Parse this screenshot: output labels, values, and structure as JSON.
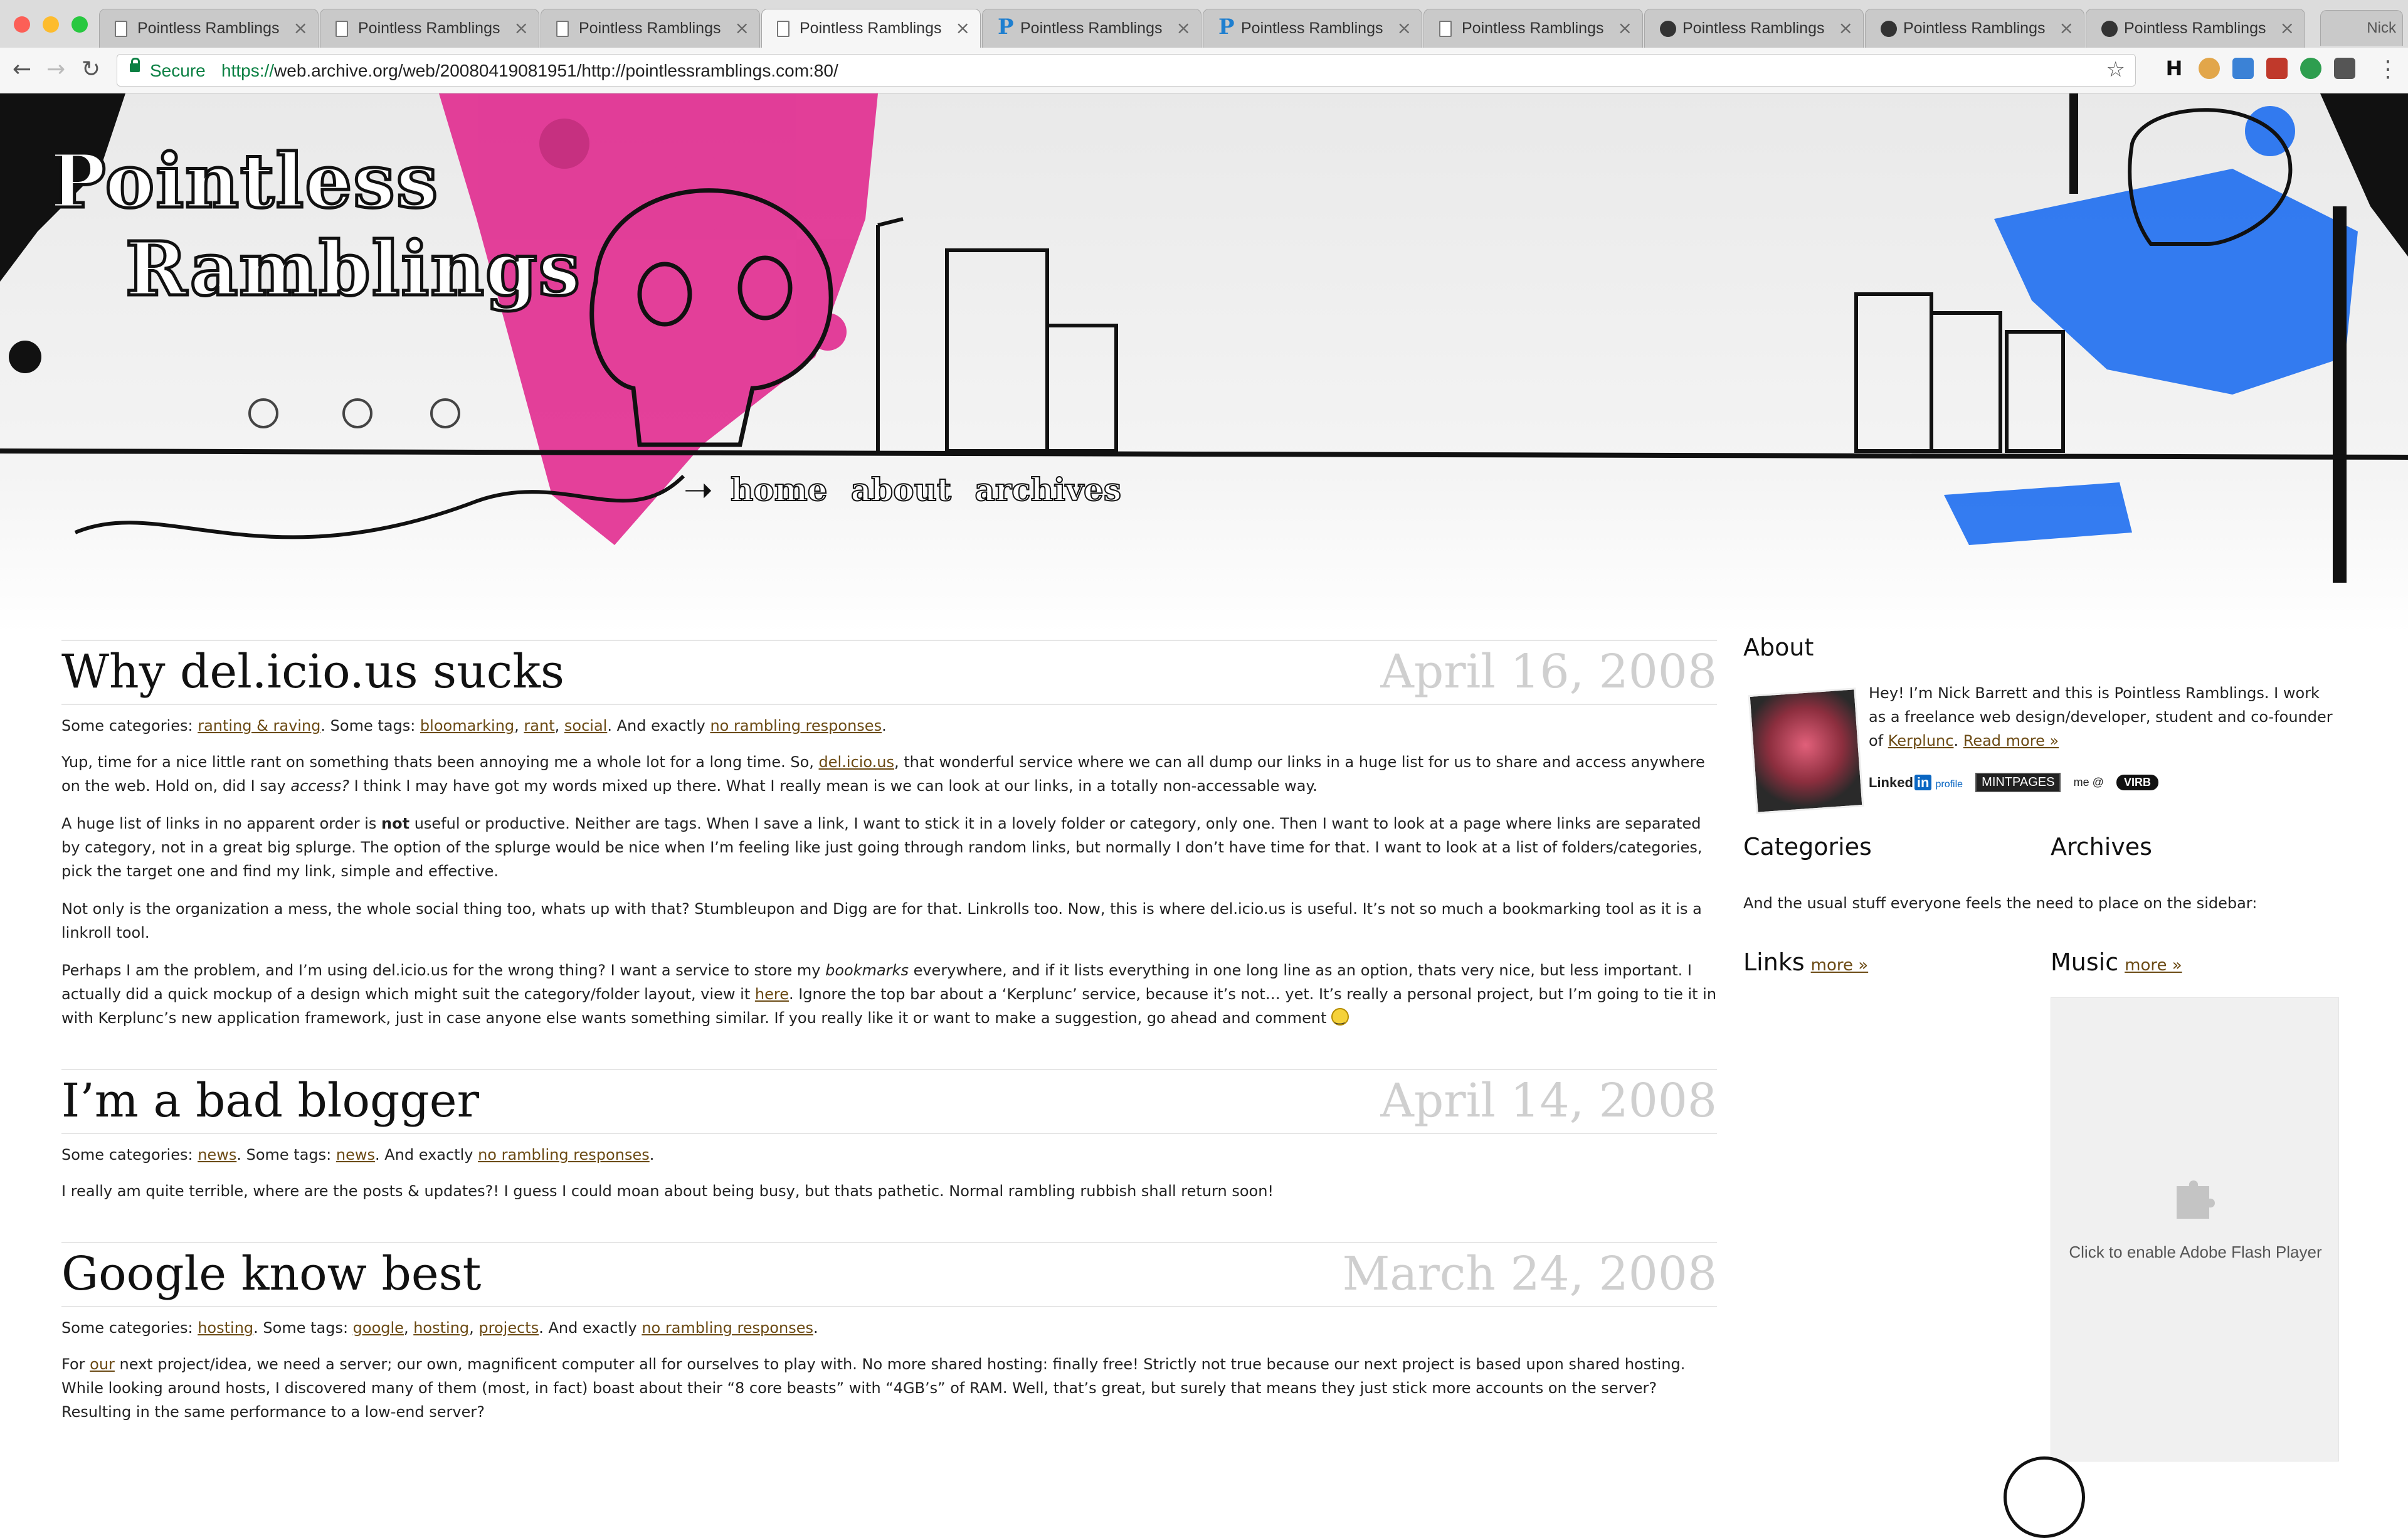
{
  "browser": {
    "tabs": [
      {
        "title": "Pointless Ramblings",
        "icon": "page-icon",
        "active": false
      },
      {
        "title": "Pointless Ramblings",
        "icon": "page-icon",
        "active": false
      },
      {
        "title": "Pointless Ramblings",
        "icon": "page-icon",
        "active": false
      },
      {
        "title": "Pointless Ramblings",
        "icon": "page-icon",
        "active": true
      },
      {
        "title": "Pointless Ramblings",
        "icon": "p-icon",
        "active": false
      },
      {
        "title": "Pointless Ramblings",
        "icon": "p-icon",
        "active": false
      },
      {
        "title": "Pointless Ramblings",
        "icon": "page-icon",
        "active": false
      },
      {
        "title": "Pointless Ramblings",
        "icon": "dark-icon",
        "active": false
      },
      {
        "title": "Pointless Ramblings",
        "icon": "dark-icon",
        "active": false
      },
      {
        "title": "Pointless Ramblings",
        "icon": "dark-icon",
        "active": false
      }
    ],
    "tab_close": "×",
    "secure_label": "Secure",
    "url_scheme": "https://",
    "url_rest": "web.archive.org/web/20080419081951/http://pointlessramblings.com:80/",
    "user_initials": "Nick",
    "ext_h": "H"
  },
  "site": {
    "logo_line1": "Pointless",
    "logo_line2": "Ramblings",
    "nav": [
      "home",
      "about",
      "archives"
    ]
  },
  "posts": [
    {
      "title": "Why del.icio.us sucks",
      "date": "April 16, 2008",
      "meta": {
        "cat_prefix": "Some categories: ",
        "categories": [
          "ranting & raving"
        ],
        "tag_prefix": ". Some tags: ",
        "tags": [
          "bloomarking",
          "rant",
          "social"
        ],
        "resp_prefix": ". And exactly ",
        "responses": "no rambling responses",
        "end": "."
      },
      "paragraphs": [
        [
          "Yup, time for a nice little rant on something thats been annoying me a whole lot for a long time. So, ",
          {
            "link": "del.icio.us"
          },
          ", that wonderful service where we can all dump our links in a huge list for us to share and access anywhere on the web. Hold on, did I say ",
          {
            "em": "access?"
          },
          " I think I may have got my words mixed up there. What I really mean is we can look at our links, in a totally non-accessable way."
        ],
        [
          "A huge list of links in no apparent order is ",
          {
            "strong": "not"
          },
          " useful or productive. Neither are tags. When I save a link, I want to stick it in a lovely folder or category, only one. Then I want to look at a page where links are separated by category, not in a great big splurge. The option of the splurge would be nice when I’m feeling like just going through random links, but normally I don’t have time for that. I want to look at a list of folders/categories, pick the target one and find my link, simple and effective."
        ],
        [
          "Not only is the organization a mess, the whole social thing too, whats up with that? Stumbleupon and Digg are for that. Linkrolls too. Now, this is where del.icio.us is useful. It’s not so much a bookmarking tool as it is a linkroll tool."
        ],
        [
          "Perhaps I am the problem, and I’m using del.icio.us for the wrong thing? I want a service to store my ",
          {
            "em": "bookmarks"
          },
          " everywhere, and if it lists everything in one long line as an option, thats very nice, but less important. I actually did a quick mockup of a design which might suit the category/folder layout, view it ",
          {
            "link": "here"
          },
          ". Ignore the top bar about a ‘Kerplunc’ service, because it’s not… yet. It’s really a personal project, but I’m going to tie it in with Kerplunc’s new application framework, just in case anyone else wants something similar. If you really like it or want to make a suggestion, go ahead and comment ",
          {
            "smiley": true
          }
        ]
      ]
    },
    {
      "title": "I’m a bad blogger",
      "date": "April 14, 2008",
      "meta": {
        "cat_prefix": "Some categories: ",
        "categories": [
          "news"
        ],
        "tag_prefix": ". Some tags: ",
        "tags": [
          "news"
        ],
        "resp_prefix": ". And exactly ",
        "responses": "no rambling responses",
        "end": "."
      },
      "paragraphs": [
        [
          "I really am quite terrible, where are the posts & updates?! I guess I could moan about being busy, but thats pathetic. Normal rambling rubbish shall return soon!"
        ]
      ]
    },
    {
      "title": "Google know best",
      "date": "March 24, 2008",
      "meta": {
        "cat_prefix": "Some categories: ",
        "categories": [
          "hosting"
        ],
        "tag_prefix": ". Some tags: ",
        "tags": [
          "google",
          "hosting",
          "projects"
        ],
        "resp_prefix": ". And exactly ",
        "responses": "no rambling responses",
        "end": "."
      },
      "paragraphs": [
        [
          "For ",
          {
            "link": "our"
          },
          " next project/idea, we need a server; our own, magnificent computer all for ourselves to play with. No more shared hosting: finally free! Strictly not true because our next project is based upon shared hosting. While looking around hosts, I discovered many of them (most, in fact) boast about their “8 core beasts” with “4GB’s” of RAM. Well, that’s great, but surely that means they just stick more accounts on the server? Resulting in the same performance to a low-end server?"
        ]
      ]
    }
  ],
  "sidebar": {
    "about_heading": "About",
    "about_text_1": "Hey! I’m Nick Barrett and this is Pointless Ramblings. I work as a freelance web design/developer, student and co-founder of ",
    "about_link": "Kerplunc",
    "about_text_2": ". ",
    "about_more": "Read more »",
    "linkedin_label": "Linked",
    "linkedin_in": "in",
    "linkedin_profile": "profile",
    "mintpages": "MINTPAGES",
    "me_at": "me @",
    "virb": "VIRB",
    "categories_heading": "Categories",
    "archives_heading": "Archives",
    "usual_text": "And the usual stuff everyone feels the need to place on the sidebar:",
    "links_heading": "Links",
    "links_more": "more »",
    "music_heading": "Music",
    "music_more": "more »",
    "flash_text": "Click to enable Adobe Flash Player"
  }
}
